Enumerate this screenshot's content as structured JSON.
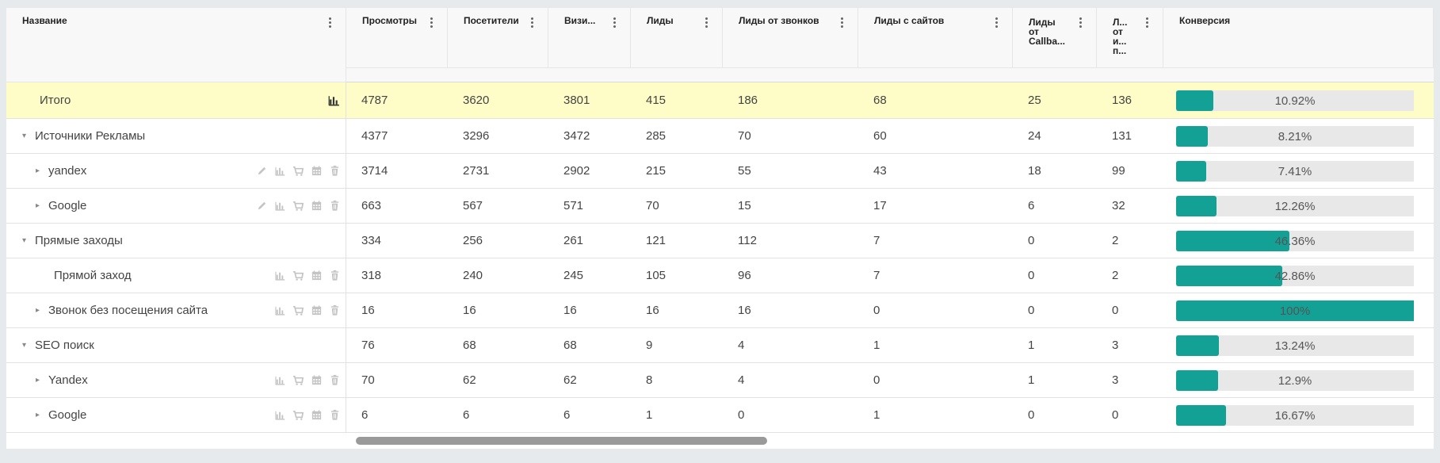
{
  "columns": [
    {
      "label": "Название"
    },
    {
      "label": "Просмотры"
    },
    {
      "label": "Посетители"
    },
    {
      "label": "Визи..."
    },
    {
      "label": "Лиды"
    },
    {
      "label": "Лиды от звонков"
    },
    {
      "label": "Лиды с сайтов"
    },
    {
      "label": "Лиды\nот\nCallba..."
    },
    {
      "label": "Л...\nот\nи...\nп..."
    },
    {
      "label": "Конверсия"
    }
  ],
  "rows": [
    {
      "name": "Итого",
      "type": "total",
      "level": 0,
      "tools": [
        "stats"
      ],
      "values": [
        "4787",
        "3620",
        "3801",
        "415",
        "186",
        "68",
        "25",
        "136"
      ],
      "conversion": "10.92%",
      "conversion_value": 10.92
    },
    {
      "name": "Источники Рекламы",
      "type": "group",
      "level": 0,
      "expanded": true,
      "tools": [],
      "values": [
        "4377",
        "3296",
        "3472",
        "285",
        "70",
        "60",
        "24",
        "131"
      ],
      "conversion": "8.21%",
      "conversion_value": 8.21
    },
    {
      "name": "yandex",
      "type": "item",
      "level": 1,
      "expanded": false,
      "tools": [
        "edit",
        "stats",
        "cart",
        "calendar",
        "trash"
      ],
      "values": [
        "3714",
        "2731",
        "2902",
        "215",
        "55",
        "43",
        "18",
        "99"
      ],
      "conversion": "7.41%",
      "conversion_value": 7.41
    },
    {
      "name": "Google",
      "type": "item",
      "level": 1,
      "expanded": false,
      "tools": [
        "edit",
        "stats",
        "cart",
        "calendar",
        "trash"
      ],
      "values": [
        "663",
        "567",
        "571",
        "70",
        "15",
        "17",
        "6",
        "32"
      ],
      "conversion": "12.26%",
      "conversion_value": 12.26
    },
    {
      "name": "Прямые заходы",
      "type": "group",
      "level": 0,
      "expanded": true,
      "tools": [],
      "values": [
        "334",
        "256",
        "261",
        "121",
        "112",
        "7",
        "0",
        "2"
      ],
      "conversion": "46.36%",
      "conversion_value": 46.36
    },
    {
      "name": "Прямой заход",
      "type": "leaf",
      "level": 2,
      "tools": [
        "stats",
        "cart",
        "calendar",
        "trash"
      ],
      "values": [
        "318",
        "240",
        "245",
        "105",
        "96",
        "7",
        "0",
        "2"
      ],
      "conversion": "42.86%",
      "conversion_value": 42.86
    },
    {
      "name": "Звонок без посещения сайта",
      "type": "item",
      "level": 1,
      "expanded": false,
      "tools": [
        "stats",
        "cart",
        "calendar",
        "trash"
      ],
      "values": [
        "16",
        "16",
        "16",
        "16",
        "16",
        "0",
        "0",
        "0"
      ],
      "conversion": "100%",
      "conversion_value": 100
    },
    {
      "name": "SEO поиск",
      "type": "group",
      "level": 0,
      "expanded": true,
      "tools": [],
      "values": [
        "76",
        "68",
        "68",
        "9",
        "4",
        "1",
        "1",
        "3"
      ],
      "conversion": "13.24%",
      "conversion_value": 13.24
    },
    {
      "name": "Yandex",
      "type": "item",
      "level": 1,
      "expanded": false,
      "tools": [
        "stats",
        "cart",
        "calendar",
        "trash"
      ],
      "values": [
        "70",
        "62",
        "62",
        "8",
        "4",
        "0",
        "1",
        "3"
      ],
      "conversion": "12.9%",
      "conversion_value": 12.9
    },
    {
      "name": "Google",
      "type": "item",
      "level": 1,
      "expanded": false,
      "tools": [
        "stats",
        "cart",
        "calendar",
        "trash"
      ],
      "values": [
        "6",
        "6",
        "6",
        "1",
        "0",
        "1",
        "0",
        "0"
      ],
      "conversion": "16.67%",
      "conversion_value": 16.67
    }
  ],
  "colors": {
    "accent": "#13a095",
    "total_row": "#fefdc8",
    "track": "#e8e8e8"
  }
}
